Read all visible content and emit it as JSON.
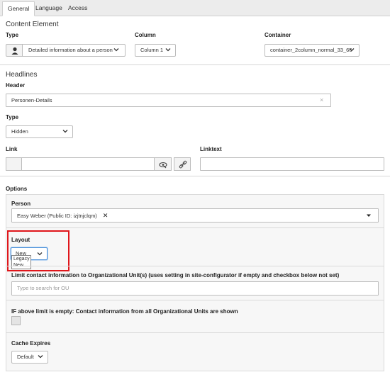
{
  "tabs": [
    {
      "label": "General",
      "active": true
    },
    {
      "label": "Language",
      "active": false
    },
    {
      "label": "Access",
      "active": false
    }
  ],
  "content_element": {
    "title": "Content Element",
    "type_label": "Type",
    "type_value": "Detailed information about a person",
    "column_label": "Column",
    "column_value": "Column 1",
    "container_label": "Container",
    "container_value": "container_2column_normal_33_66"
  },
  "headlines": {
    "title": "Headlines",
    "header_label": "Header",
    "header_value": "Personen-Details",
    "clear_glyph": "×",
    "type_label": "Type",
    "type_value": "Hidden",
    "link_label": "Link",
    "linktext_label": "Linktext"
  },
  "options": {
    "title": "Options",
    "person_label": "Person",
    "person_value": "Easy Weber (Public ID: izjtnjclqm)",
    "remove_glyph": "✕",
    "layout_label": "Layout",
    "layout_value": "New",
    "layout_options": [
      "Legacy",
      "New"
    ],
    "limit_label": "Limit contact information to Organizational Unit(s) (uses setting in site-configurator if empty and checkbox below not set)",
    "limit_placeholder": "Type to search for OU",
    "if_empty_label": "IF above limit is empty: Contact information from all Organizational Units are shown",
    "cache_label": "Cache Expires",
    "cache_value": "Default"
  },
  "colors": {
    "highlight": "#e0161b",
    "focus": "#4a90d9"
  }
}
